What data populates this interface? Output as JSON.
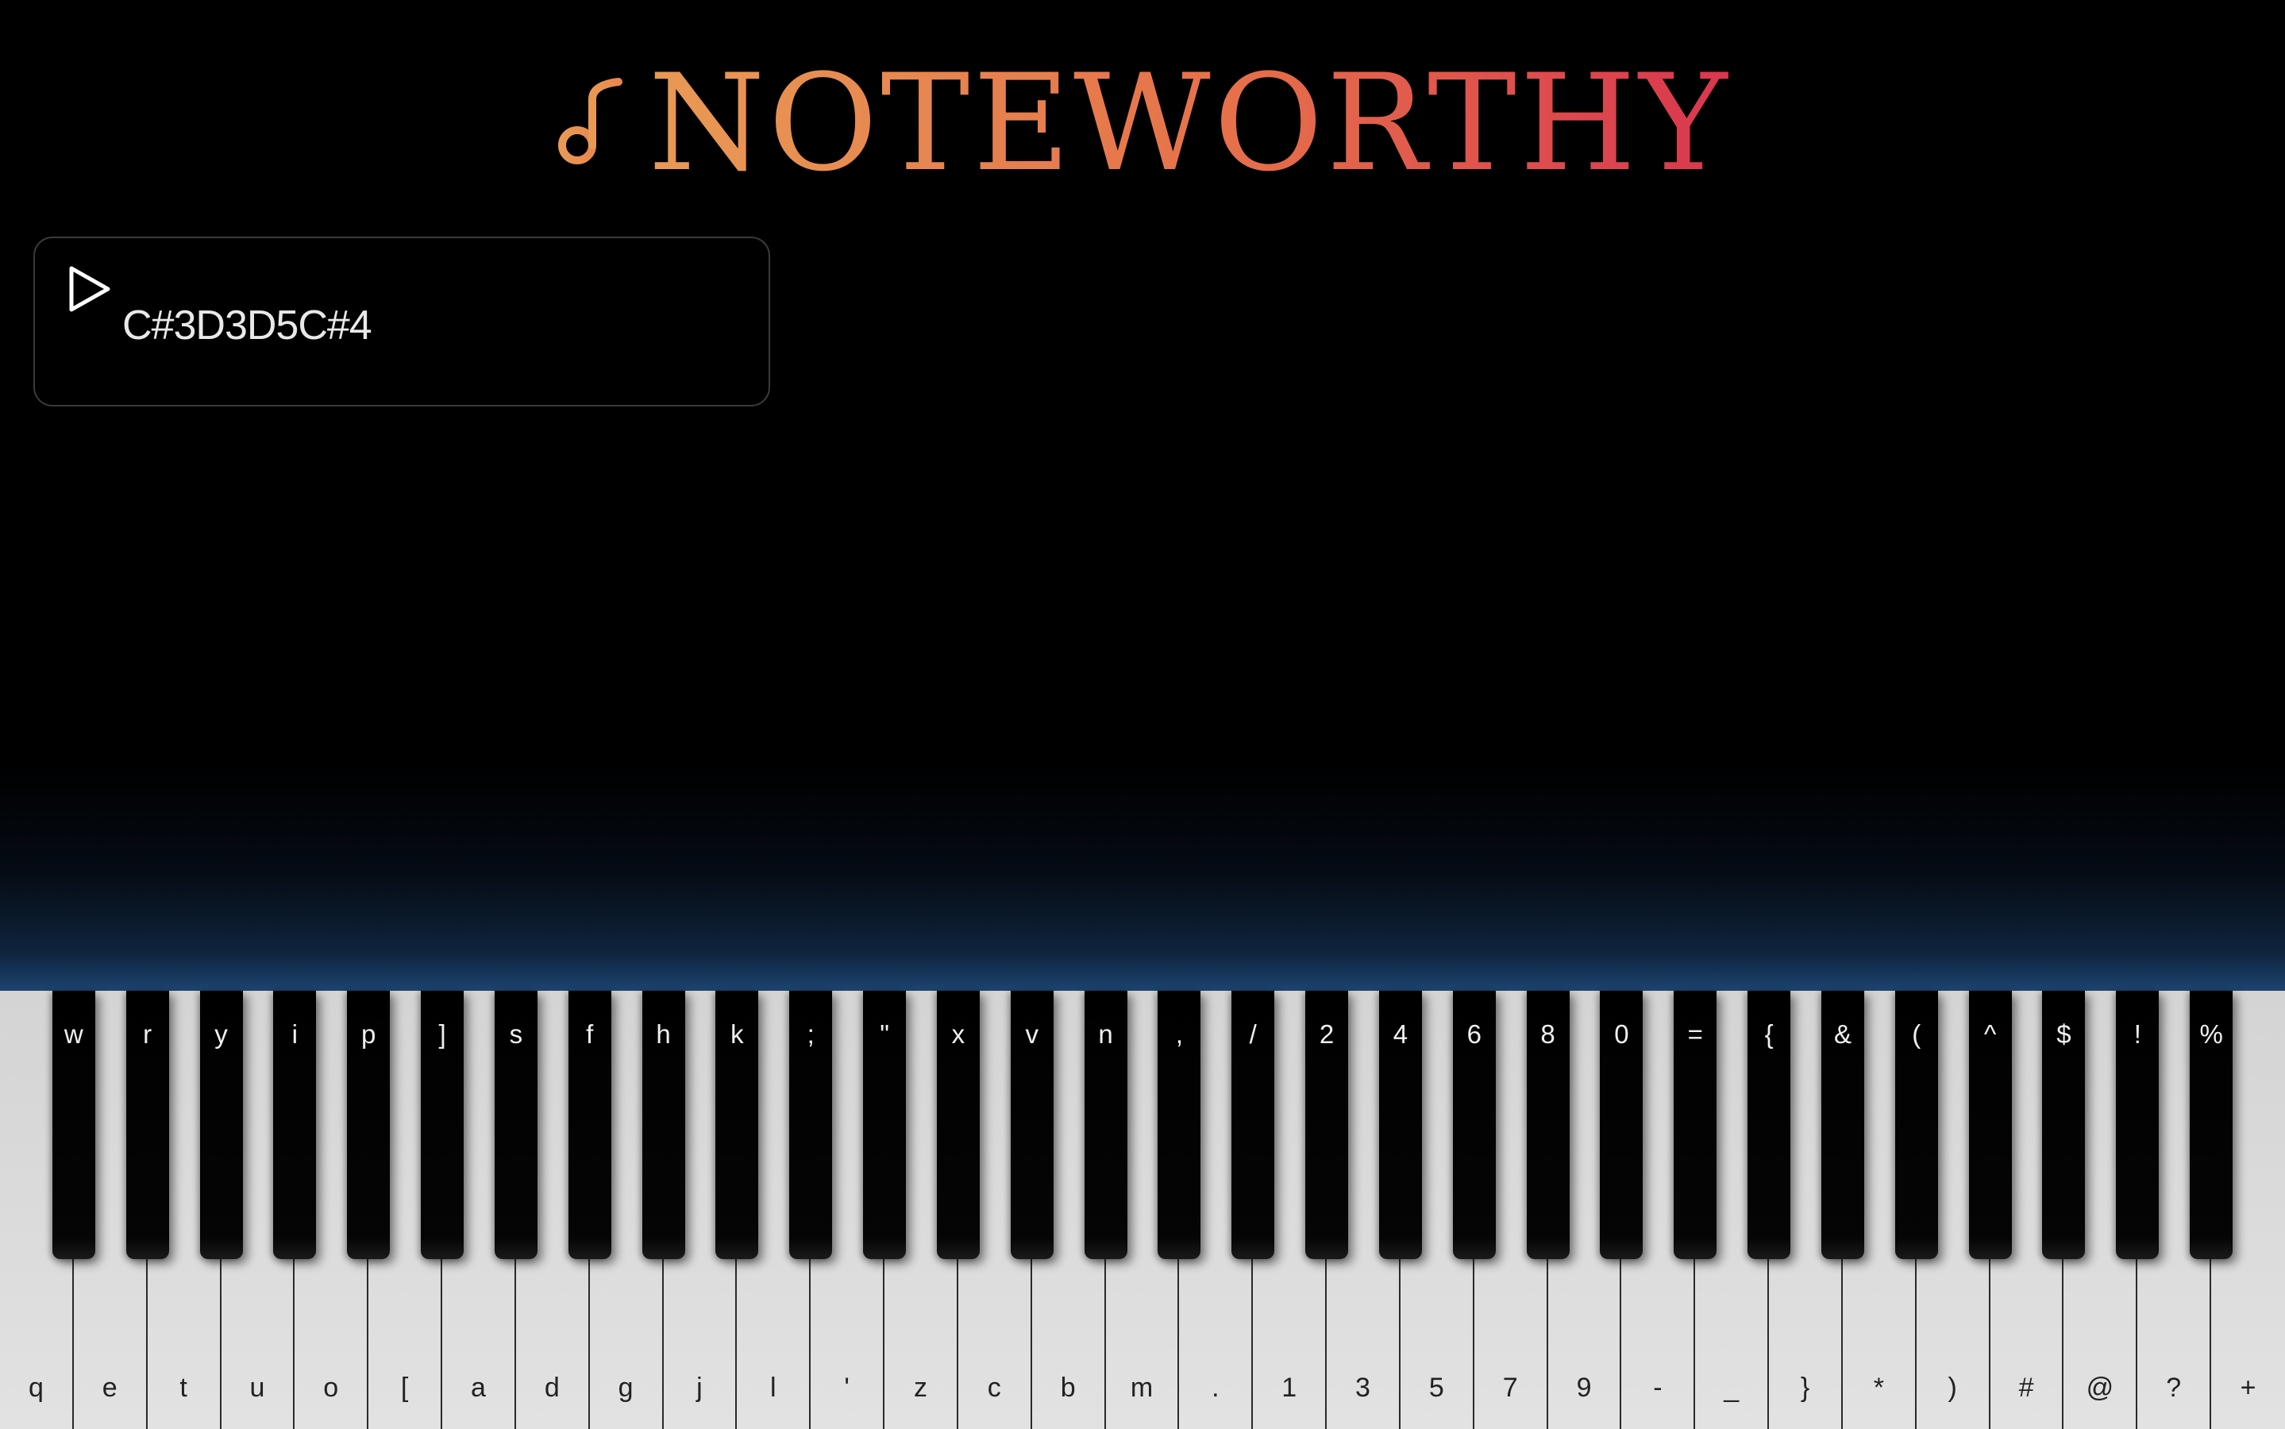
{
  "app": {
    "title": "NOTEWORTHY",
    "logo_icon": "music-note-icon",
    "title_gradient": [
      "#e89a55",
      "#e56f4a",
      "#d9364f"
    ]
  },
  "sequence": {
    "play_icon": "play-icon",
    "notes": "C#3D3D5C#4"
  },
  "keyboard": {
    "white_keys": [
      "q",
      "e",
      "t",
      "u",
      "o",
      "[",
      "a",
      "d",
      "g",
      "j",
      "l",
      "'",
      "z",
      "c",
      "b",
      "m",
      ".",
      "1",
      "3",
      "5",
      "7",
      "9",
      "-",
      "_",
      "}",
      "*",
      ")",
      "#",
      "@",
      "?",
      "+"
    ],
    "black_keys": [
      "w",
      "r",
      "y",
      "i",
      "p",
      "]",
      "s",
      "f",
      "h",
      "k",
      ";",
      "\"",
      "x",
      "v",
      "n",
      ",",
      "/",
      "2",
      "4",
      "6",
      "8",
      "0",
      "=",
      "{",
      "&",
      "(",
      "^",
      "$",
      "!",
      "%"
    ]
  }
}
